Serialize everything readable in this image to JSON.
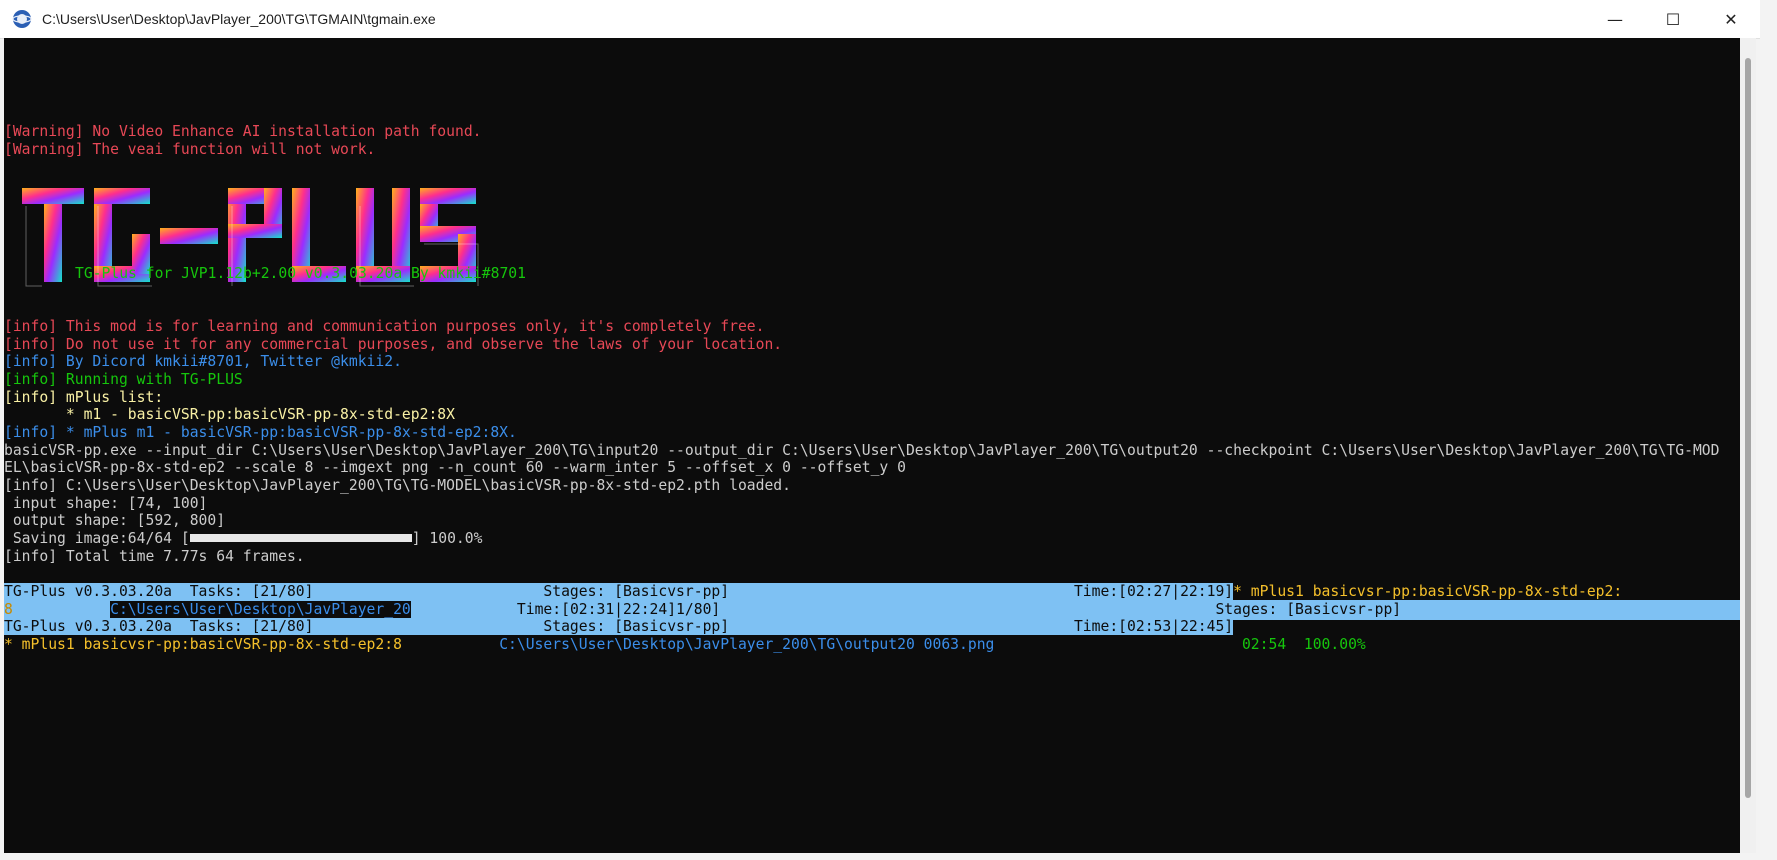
{
  "window": {
    "title": "C:\\Users\\User\\Desktop\\JavPlayer_200\\TG\\TGMAIN\\tgmain.exe",
    "minimize_glyph": "—",
    "maximize_glyph": "☐",
    "close_glyph": "✕"
  },
  "icons": {
    "app": "app-globe-icon",
    "minimize": "minimize-icon",
    "maximize": "maximize-icon",
    "close": "close-icon"
  },
  "colors": {
    "console_bg": "#0c0c0c",
    "warning_red": "#e74856",
    "info_blue": "#3b8eea",
    "info_green": "#16c60c",
    "highlight_bg": "#7ec1f3"
  },
  "logo": {
    "text": "TG-PLUS",
    "subtitle": "TG-Plus for JVP1.12b+2.00 v0.3.03.20a By kmkii#8701"
  },
  "console": {
    "warn1": "[Warning] No Video Enhance AI installation path found.",
    "warn2": "[Warning] The veai function will not work.",
    "info1": "[info] This mod is for learning and communication purposes only, it's completely free.",
    "info2": "[info] Do not use it for any commercial purposes, and observe the laws of your location.",
    "info3": "[info] By Dicord kmkii#8701, Twitter @kmkii2.",
    "info4": "[info] Running with TG-PLUS",
    "info5": "[info] mPlus list:",
    "list_item": "       * m1 - basicVSR-pp:basicVSR-pp-8x-std-ep2:8X",
    "info6": "[info] * mPlus m1 - basicVSR-pp:basicVSR-pp-8x-std-ep2:8X.",
    "cmd1": "basicVSR-pp.exe --input_dir C:\\Users\\User\\Desktop\\JavPlayer_200\\TG\\input20 --output_dir C:\\Users\\User\\Desktop\\JavPlayer_200\\TG\\output20 --checkpoint C:\\Users\\User\\Desktop\\JavPlayer_200\\TG\\TG-MOD",
    "cmd2": "EL\\basicVSR-pp-8x-std-ep2 --scale 8 --imgext png --n_count 60 --warm_inter 5 --offset_x 0 --offset_y 0",
    "loaded": "[info] C:\\Users\\User\\Desktop\\JavPlayer_200\\TG\\TG-MODEL\\basicVSR-pp-8x-std-ep2.pth loaded.",
    "input_shape": " input shape: [74, 100]",
    "output_shape": " output shape: [592, 800]",
    "saving_prefix": " Saving image:64/64 [",
    "saving_suffix": "] 100.0%",
    "saving_progress": 1.0,
    "total_time": "[info] Total time 7.77s 64 frames."
  },
  "status": {
    "r1_left": "TG-Plus v0.3.03.20a  Tasks: [21/80]                          Stages: [Basicvsr-pp]                                       Time:[02:27|22:19]",
    "r1_right": "* mPlus1 basicvsr-pp:basicVSR-pp-8x-std-ep2:",
    "r2_a": "8           ",
    "r2_path": "C:\\Users\\User\\Desktop\\JavPlayer_20",
    "r2_rest": "            Time:[02:31|22:24]1/80]                                                        Stages: [Basicvsr-pp]",
    "r3": "TG-Plus v0.3.03.20a  Tasks: [21/80]                          Stages: [Basicvsr-pp]                                       Time:[02:53|22:45]",
    "r4_a": "* mPlus1 basicvsr-pp:basicVSR-pp-8x-std-ep2:8           ",
    "r4_path": "C:\\Users\\User\\Desktop\\JavPlayer_200\\TG\\output20 0063.png",
    "r4_gap": "                            ",
    "r4_time": "02:54  100.00%"
  }
}
